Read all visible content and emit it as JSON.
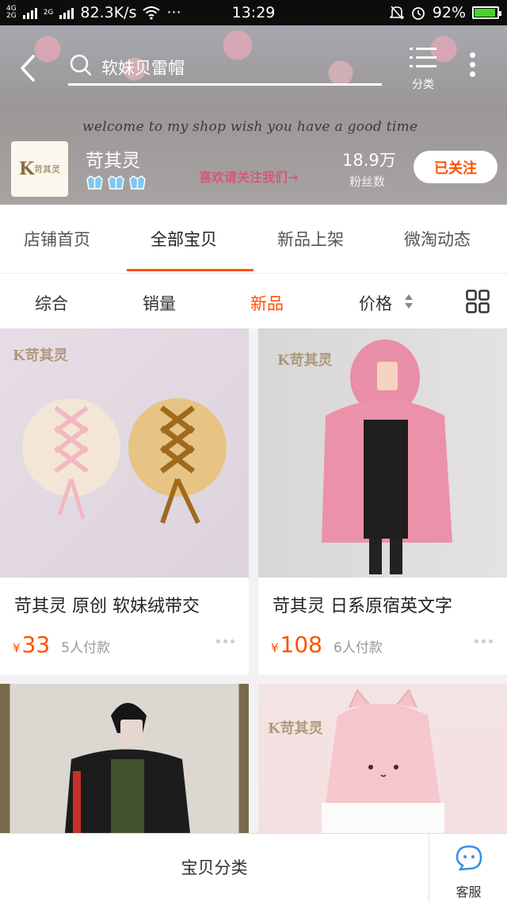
{
  "status_bar": {
    "network_top": "4G",
    "network_bottom": "2G",
    "network2": "2G",
    "speed": "82.3K/s",
    "more": "···",
    "time": "13:29",
    "battery": "92%",
    "battery_level": 0.92
  },
  "header": {
    "search_text": "软妹贝雷帽",
    "category_label": "分类"
  },
  "shop": {
    "welcome": "welcome to my shop wish you have a good time",
    "logo_text": "K",
    "logo_subtext": "苛其灵",
    "name": "苛其灵",
    "banner_text": "喜欢请关注我们→",
    "fans_count": "18.9万",
    "fans_label": "粉丝数",
    "follow_label": "已关注"
  },
  "tabs": [
    "店铺首页",
    "全部宝贝",
    "新品上架",
    "微淘动态"
  ],
  "sort": {
    "items": [
      "综合",
      "销量",
      "新品",
      "价格"
    ],
    "active": "新品"
  },
  "products": [
    {
      "title": "苛其灵 原创 软妹绒带交",
      "currency": "¥",
      "price": "33",
      "sold": "5人付款",
      "watermark": "K苛其灵"
    },
    {
      "title": "苛其灵 日系原宿英文字",
      "currency": "¥",
      "price": "108",
      "sold": "6人付款",
      "watermark": "K苛其灵"
    },
    {
      "watermark": ""
    },
    {
      "watermark": "K苛其灵"
    }
  ],
  "bottom_bar": {
    "category": "宝贝分类",
    "service": "客服"
  },
  "colors": {
    "accent": "#ff5000",
    "battery_green": "#4bd12e",
    "banner_pink": "#d4577a"
  }
}
